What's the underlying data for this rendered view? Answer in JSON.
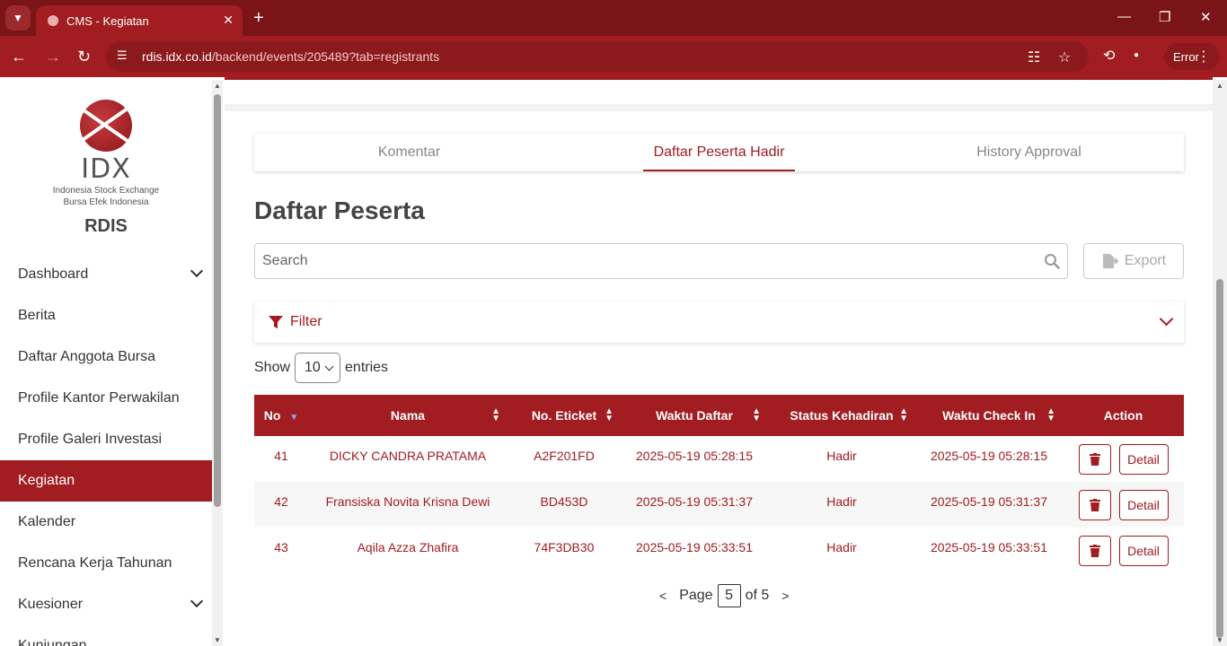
{
  "browser": {
    "tab_title": "CMS - Kegiatan",
    "url_host": "rdis.idx.co.id",
    "url_path": "/backend/events/205489?tab=registrants",
    "error_label": "Error"
  },
  "sidebar": {
    "logo_text": "IDX",
    "logo_sub1": "Indonesia Stock Exchange",
    "logo_sub2": "Bursa  Efek  Indonesia",
    "app_name": "RDIS",
    "items": [
      {
        "label": "Dashboard"
      },
      {
        "label": "Berita"
      },
      {
        "label": "Daftar Anggota Bursa"
      },
      {
        "label": "Profile Kantor Perwakilan"
      },
      {
        "label": "Profile Galeri Investasi"
      },
      {
        "label": "Kegiatan"
      },
      {
        "label": "Kalender"
      },
      {
        "label": "Rencana Kerja Tahunan"
      },
      {
        "label": "Kuesioner"
      },
      {
        "label": "Kunjungan"
      }
    ]
  },
  "tabs": [
    {
      "label": "Komentar"
    },
    {
      "label": "Daftar Peserta Hadir"
    },
    {
      "label": "History Approval"
    }
  ],
  "page_title": "Daftar Peserta",
  "search": {
    "placeholder": "Search"
  },
  "export_label": "Export",
  "filter_label": "Filter",
  "entries": {
    "show": "Show",
    "value": "10",
    "suffix": "entries"
  },
  "table": {
    "headers": [
      "No",
      "Nama",
      "No. Eticket",
      "Waktu Daftar",
      "Status Kehadiran",
      "Waktu Check In",
      "Action"
    ],
    "rows": [
      {
        "no": "41",
        "nama": "DICKY CANDRA PRATAMA",
        "eticket": "A2F201FD",
        "daftar": "2025-05-19 05:28:15",
        "status": "Hadir",
        "checkin": "2025-05-19 05:28:15"
      },
      {
        "no": "42",
        "nama": "Fransiska Novita Krisna Dewi",
        "eticket": "BD453D",
        "daftar": "2025-05-19 05:31:37",
        "status": "Hadir",
        "checkin": "2025-05-19 05:31:37"
      },
      {
        "no": "43",
        "nama": "Aqila Azza Zhafira",
        "eticket": "74F3DB30",
        "daftar": "2025-05-19 05:33:51",
        "status": "Hadir",
        "checkin": "2025-05-19 05:33:51"
      }
    ],
    "detail_label": "Detail"
  },
  "pagination": {
    "prev": "<",
    "page_label": "Page",
    "current": "5",
    "of_label": "of 5",
    "next": ">"
  },
  "colors": {
    "brand": "#a11d21",
    "tabbar": "#7a1416"
  }
}
